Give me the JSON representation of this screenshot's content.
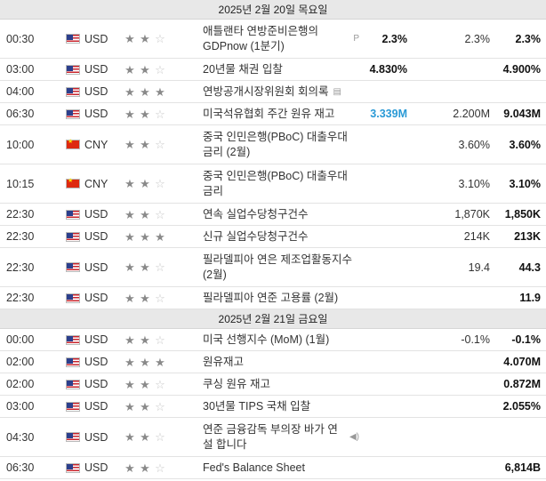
{
  "days": [
    {
      "label": "2025년 2월 20일 목요일",
      "events": [
        {
          "time": "00:30",
          "currency": "USD",
          "flag": "us",
          "importance": 2,
          "event": "애틀랜타 연방준비은행의 GDPnow (1분기)",
          "icon": "preliminary-icon",
          "icon_glyph": "P",
          "actual": "2.3%",
          "actual_style": "bold",
          "forecast": "2.3%",
          "previous": "2.3%",
          "prev_style": "bold"
        },
        {
          "time": "03:00",
          "currency": "USD",
          "flag": "us",
          "importance": 2,
          "event": "20년물 채권 입찰",
          "icon": "",
          "icon_glyph": "",
          "actual": "4.830%",
          "actual_style": "bold",
          "forecast": "",
          "previous": "4.900%",
          "prev_style": "bold"
        },
        {
          "time": "04:00",
          "currency": "USD",
          "flag": "us",
          "importance": 3,
          "event": "연방공개시장위원회 회의록",
          "icon": "document-icon",
          "icon_glyph": "▤",
          "actual": "",
          "actual_style": "",
          "forecast": "",
          "previous": "",
          "prev_style": ""
        },
        {
          "time": "06:30",
          "currency": "USD",
          "flag": "us",
          "importance": 2,
          "event": "미국석유협회 주간 원유 재고",
          "icon": "",
          "icon_glyph": "",
          "actual": "3.339M",
          "actual_style": "blue",
          "forecast": "2.200M",
          "previous": "9.043M",
          "prev_style": "bold"
        },
        {
          "time": "10:00",
          "currency": "CNY",
          "flag": "cn",
          "importance": 2,
          "event": "중국 인민은행(PBoC) 대출우대 금리 (2월)",
          "icon": "",
          "icon_glyph": "",
          "actual": "",
          "actual_style": "",
          "forecast": "3.60%",
          "previous": "3.60%",
          "prev_style": "bold"
        },
        {
          "time": "10:15",
          "currency": "CNY",
          "flag": "cn",
          "importance": 2,
          "event": "중국 인민은행(PBoC) 대출우대 금리",
          "icon": "",
          "icon_glyph": "",
          "actual": "",
          "actual_style": "",
          "forecast": "3.10%",
          "previous": "3.10%",
          "prev_style": "bold"
        },
        {
          "time": "22:30",
          "currency": "USD",
          "flag": "us",
          "importance": 2,
          "event": "연속 실업수당청구건수",
          "icon": "",
          "icon_glyph": "",
          "actual": "",
          "actual_style": "",
          "forecast": "1,870K",
          "previous": "1,850K",
          "prev_style": "bold"
        },
        {
          "time": "22:30",
          "currency": "USD",
          "flag": "us",
          "importance": 3,
          "event": "신규 실업수당청구건수",
          "icon": "",
          "icon_glyph": "",
          "actual": "",
          "actual_style": "",
          "forecast": "214K",
          "previous": "213K",
          "prev_style": "bold"
        },
        {
          "time": "22:30",
          "currency": "USD",
          "flag": "us",
          "importance": 2,
          "event": "필라델피아 연은 제조업활동지수 (2월)",
          "icon": "",
          "icon_glyph": "",
          "actual": "",
          "actual_style": "",
          "forecast": "19.4",
          "previous": "44.3",
          "prev_style": "bold"
        },
        {
          "time": "22:30",
          "currency": "USD",
          "flag": "us",
          "importance": 2,
          "event": "필라델피아 연준 고용률 (2월)",
          "icon": "",
          "icon_glyph": "",
          "actual": "",
          "actual_style": "",
          "forecast": "",
          "previous": "11.9",
          "prev_style": "bold"
        }
      ]
    },
    {
      "label": "2025년 2월 21일 금요일",
      "events": [
        {
          "time": "00:00",
          "currency": "USD",
          "flag": "us",
          "importance": 2,
          "event": "미국 선행지수 (MoM) (1월)",
          "icon": "",
          "icon_glyph": "",
          "actual": "",
          "actual_style": "",
          "forecast": "-0.1%",
          "previous": "-0.1%",
          "prev_style": "bold"
        },
        {
          "time": "02:00",
          "currency": "USD",
          "flag": "us",
          "importance": 3,
          "event": "원유재고",
          "icon": "",
          "icon_glyph": "",
          "actual": "",
          "actual_style": "",
          "forecast": "",
          "previous": "4.070M",
          "prev_style": "bold"
        },
        {
          "time": "02:00",
          "currency": "USD",
          "flag": "us",
          "importance": 2,
          "event": "쿠싱 원유 재고",
          "icon": "",
          "icon_glyph": "",
          "actual": "",
          "actual_style": "",
          "forecast": "",
          "previous": "0.872M",
          "prev_style": "bold"
        },
        {
          "time": "03:00",
          "currency": "USD",
          "flag": "us",
          "importance": 2,
          "event": "30년물 TIPS 국채 입찰",
          "icon": "",
          "icon_glyph": "",
          "actual": "",
          "actual_style": "",
          "forecast": "",
          "previous": "2.055%",
          "prev_style": "bold"
        },
        {
          "time": "04:30",
          "currency": "USD",
          "flag": "us",
          "importance": 2,
          "event": "연준 금융감독 부의장 바가 연설 합니다",
          "icon": "speaker-icon",
          "icon_glyph": "◀)",
          "actual": "",
          "actual_style": "",
          "forecast": "",
          "previous": "",
          "prev_style": ""
        },
        {
          "time": "06:30",
          "currency": "USD",
          "flag": "us",
          "importance": 2,
          "event": "Fed's Balance Sheet",
          "icon": "",
          "icon_glyph": "",
          "actual": "",
          "actual_style": "",
          "forecast": "",
          "previous": "6,814B",
          "prev_style": "bold"
        }
      ]
    }
  ]
}
